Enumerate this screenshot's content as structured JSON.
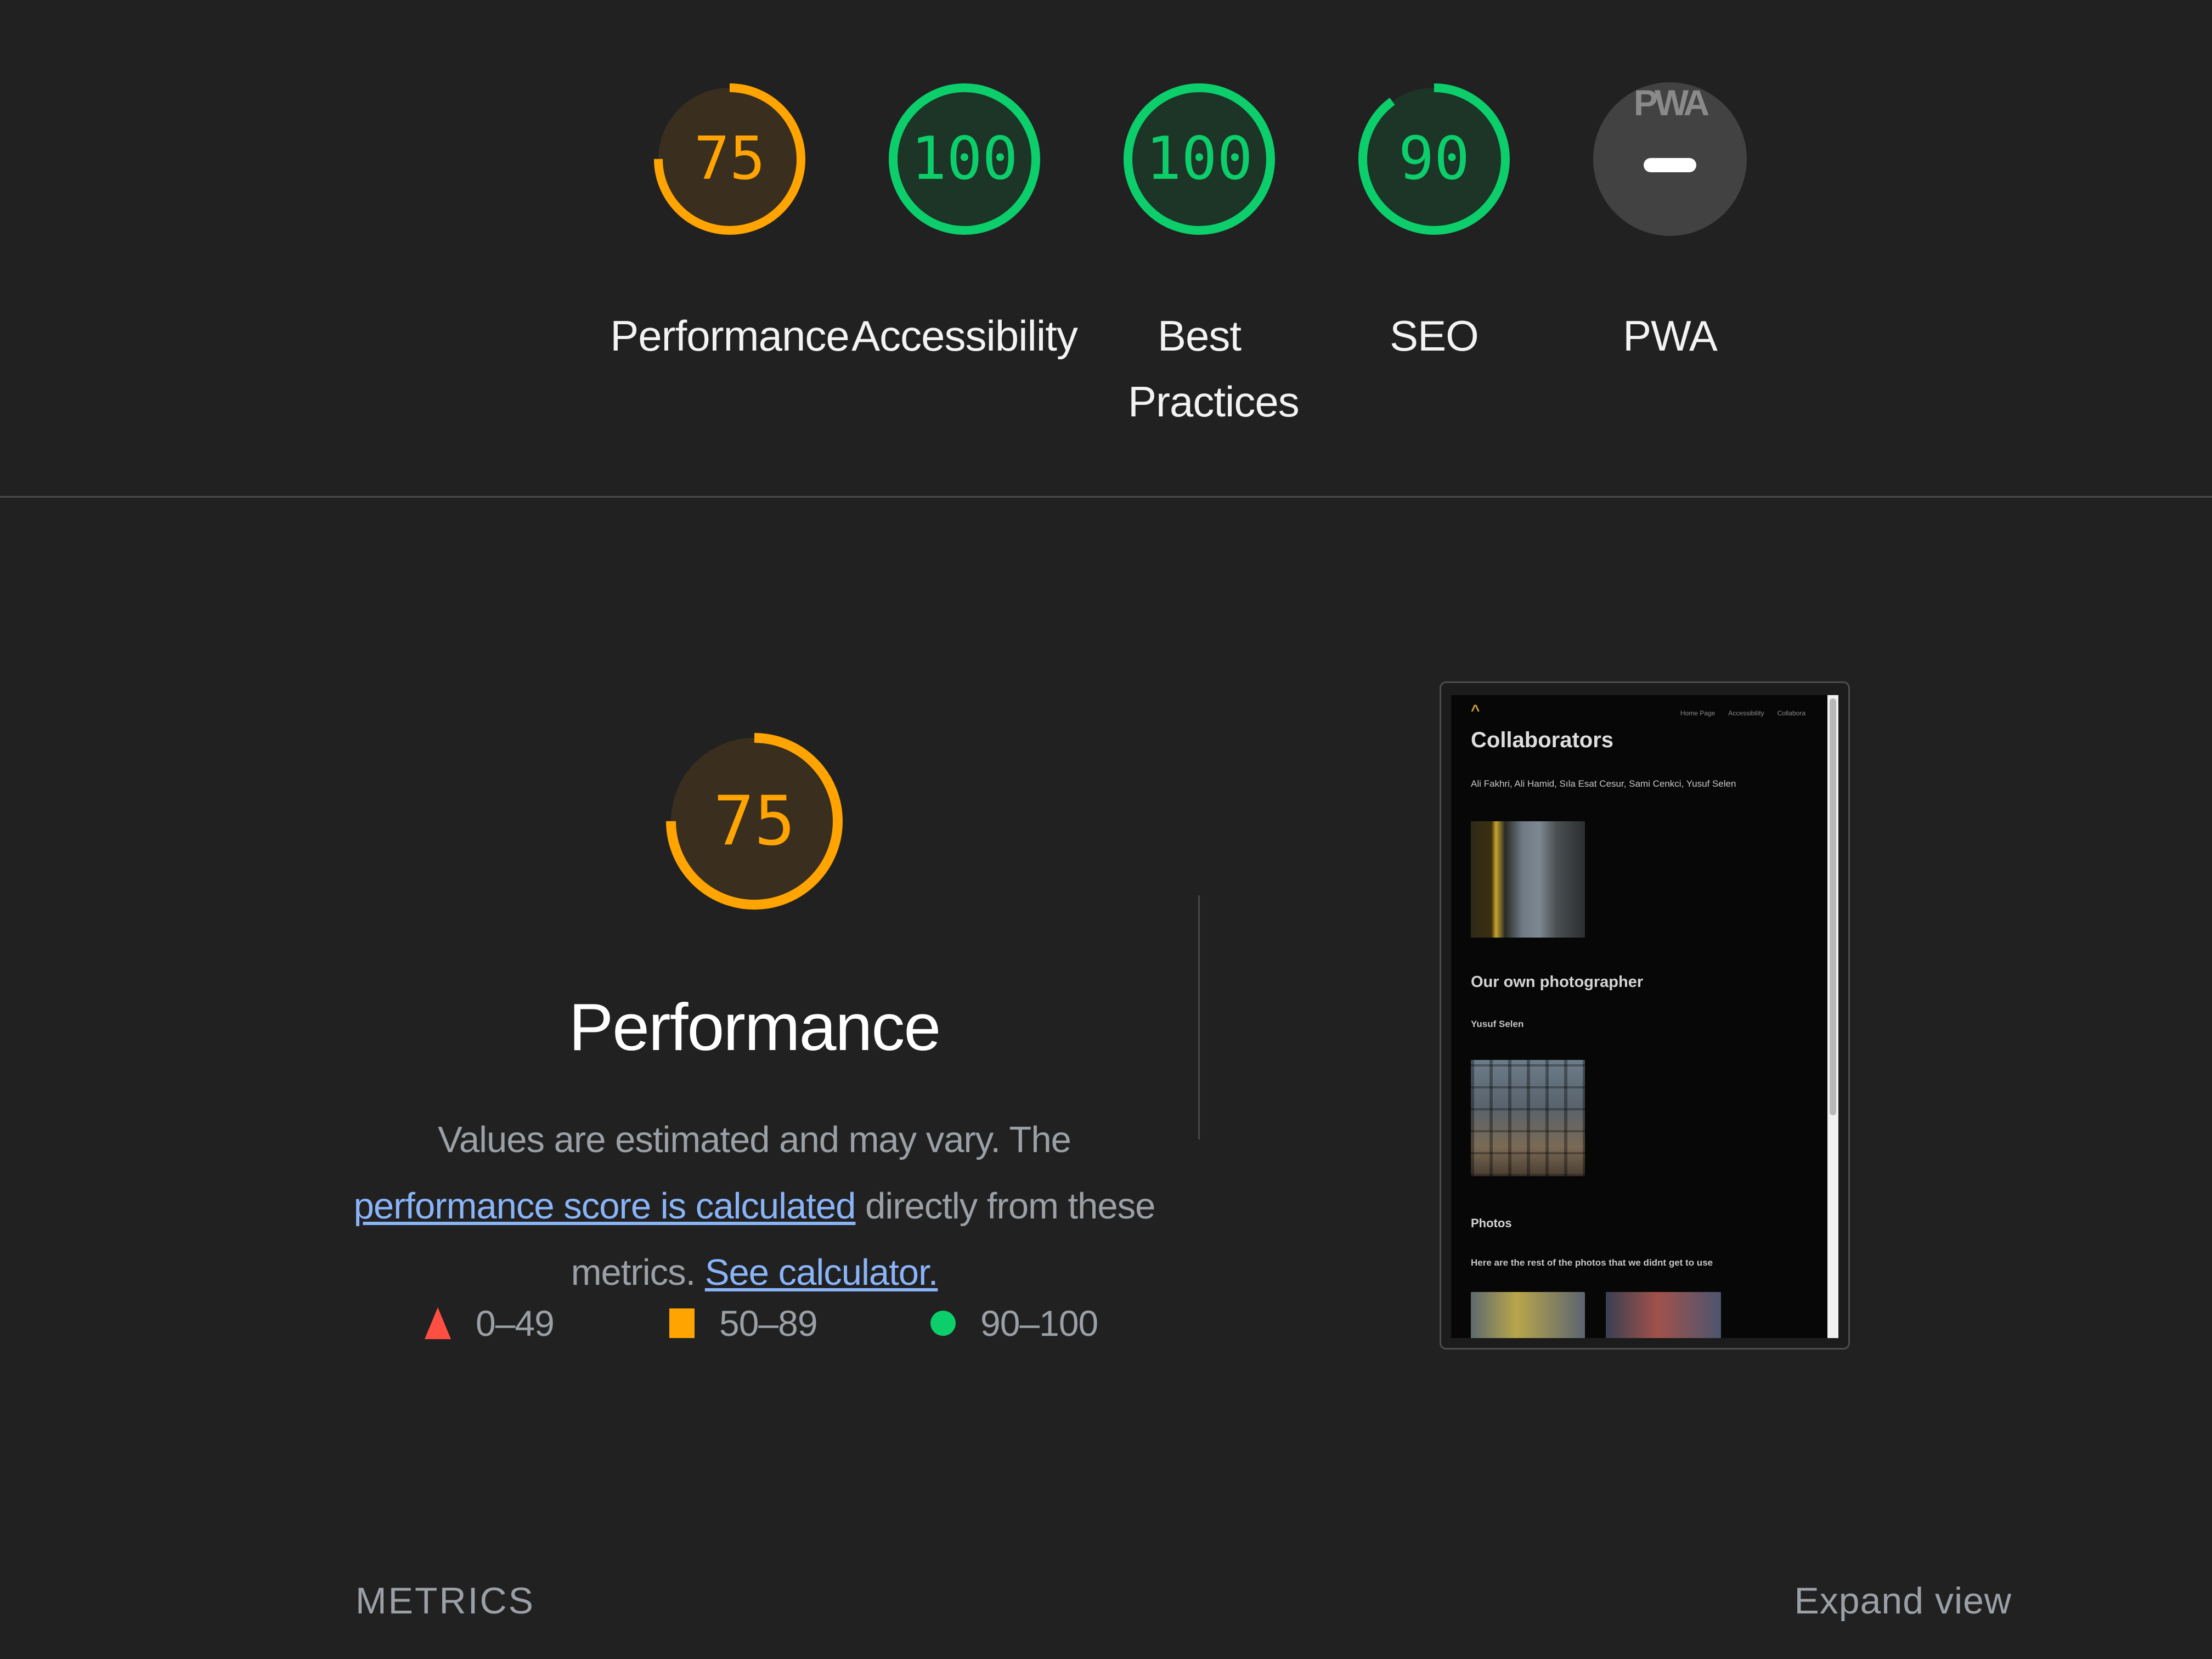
{
  "colors": {
    "background": "#212121",
    "fail": "#ff4e42",
    "average": "#ffa400",
    "pass": "#0cce6b",
    "link": "#8ab4f8",
    "muted_text": "#9aa0a6"
  },
  "categories": [
    {
      "label": "Performance",
      "score": "75",
      "score_value": 75,
      "rating": "average"
    },
    {
      "label": "Accessibility",
      "score": "100",
      "score_value": 100,
      "rating": "pass"
    },
    {
      "label": "Best Practices",
      "score": "100",
      "score_value": 100,
      "rating": "pass"
    },
    {
      "label": "SEO",
      "score": "90",
      "score_value": 90,
      "rating": "pass"
    },
    {
      "label": "PWA",
      "badge_text": "PWA",
      "rating": "na"
    }
  ],
  "performance": {
    "score": "75",
    "score_value": 75,
    "title": "Performance",
    "desc_prefix": "Values are estimated and may vary. The ",
    "desc_link1": "performance score is calculated",
    "desc_middle": " directly from these metrics. ",
    "desc_link2": "See calculator."
  },
  "legend": [
    {
      "range": "0–49",
      "shape": "triangle"
    },
    {
      "range": "50–89",
      "shape": "square"
    },
    {
      "range": "90–100",
      "shape": "circle"
    }
  ],
  "screenshot": {
    "logo": "^",
    "nav": [
      "Home Page",
      "Accessibility",
      "Collabora"
    ],
    "heading": "Collaborators",
    "names": "Ali Fakhri, Ali Hamid, Sıla Esat Cesur, Sami Cenkci, Yusuf Selen",
    "section2_title": "Our own photographer",
    "section2_name": "Yusuf Selen",
    "section3_title": "Photos",
    "section3_desc": "Here are the rest of the photos that we didnt get to use"
  },
  "metrics": {
    "header": "METRICS",
    "expand": "Expand view"
  }
}
